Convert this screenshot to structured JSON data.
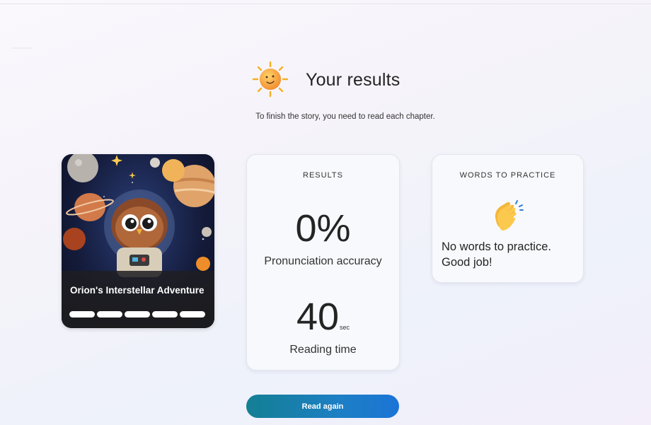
{
  "header": {
    "title": "Your results",
    "subtitle": "To finish the story, you need to read each chapter.",
    "icon": "sun-icon"
  },
  "book": {
    "title": "Orion's Interstellar Adventure",
    "chapters_total": 5,
    "chapters_read": 5,
    "image": "owl-astronaut-illustration"
  },
  "results": {
    "heading": "RESULTS",
    "accuracy_value": "0%",
    "accuracy_label": "Pronunciation accuracy",
    "time_value": "40",
    "time_unit": "sec",
    "time_label": "Reading time"
  },
  "practice": {
    "heading": "WORDS TO PRACTICE",
    "message": "No words to practice. Good job!",
    "icon": "clapping-hands-icon"
  },
  "actions": {
    "read_again_label": "Read again"
  },
  "colors": {
    "button_gradient_start": "#137f93",
    "button_gradient_end": "#1b74d6",
    "card_background": "#f8f9fc"
  }
}
